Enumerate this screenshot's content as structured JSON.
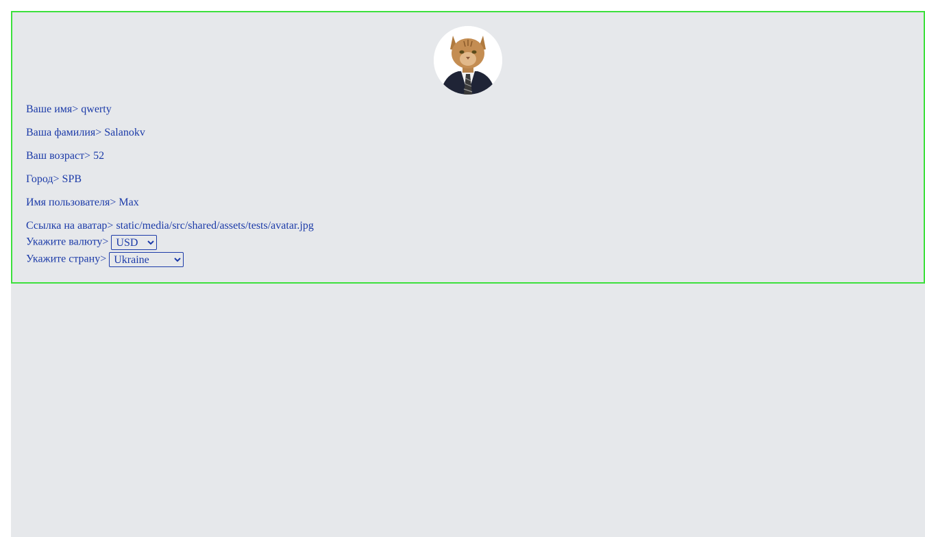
{
  "profile": {
    "avatar_alt": "avatar",
    "fields": [
      {
        "label": "Ваше имя>",
        "value": "qwerty"
      },
      {
        "label": "Ваша фамилия>",
        "value": "Salanokv"
      },
      {
        "label": "Ваш возраст>",
        "value": "52"
      },
      {
        "label": "Город>",
        "value": "SPB"
      },
      {
        "label": "Имя пользователя>",
        "value": "Max"
      },
      {
        "label": "Ссылка на аватар>",
        "value": "static/media/src/shared/assets/tests/avatar.jpg"
      }
    ],
    "currency": {
      "label": "Укажите валюту>",
      "selected": "USD"
    },
    "country": {
      "label": "Укажите страну>",
      "selected": "Ukraine"
    }
  },
  "colors": {
    "background": "#e6e8eb",
    "border": "#3ce03c",
    "text": "#1b3aa8"
  }
}
